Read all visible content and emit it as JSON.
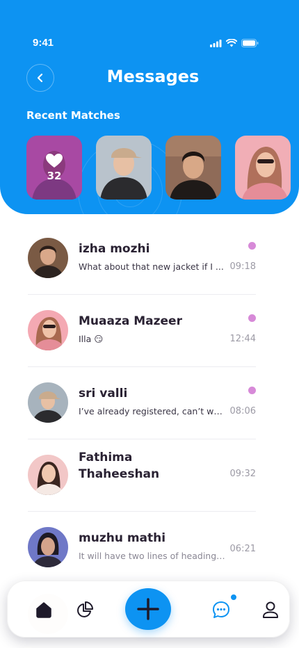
{
  "status_bar": {
    "time": "9:41"
  },
  "header": {
    "title": "Messages",
    "recent_matches_label": "Recent Matches"
  },
  "recent_matches": [
    {
      "likes_count": "32",
      "colors": [
        "#8a2f6f",
        "#5b2a46"
      ]
    },
    {
      "colors": [
        "#b8c0c8",
        "#4b3a2e"
      ]
    },
    {
      "colors": [
        "#8c6a58",
        "#2a1f1c"
      ]
    },
    {
      "colors": [
        "#f3b0b8",
        "#d88890"
      ]
    }
  ],
  "messages": [
    {
      "name": "izha mozhi",
      "preview": "What about that new jacket if I ...",
      "time": "09:18",
      "unread": true,
      "avatar_colors": [
        "#6d4a36",
        "#2c2320"
      ]
    },
    {
      "name": "Muaaza Mazeer",
      "preview": "Illa 😏",
      "time": "12:44",
      "unread": true,
      "avatar_colors": [
        "#f4a9b3",
        "#c97a82"
      ]
    },
    {
      "name": "sri valli",
      "preview": "I’ve already registered, can’t wai...",
      "time": "08:06",
      "unread": true,
      "avatar_colors": [
        "#a7b3bd",
        "#3b3530"
      ]
    },
    {
      "name": "Fathima Thaheeshan",
      "preview": "",
      "time": "09:32",
      "unread": false,
      "avatar_colors": [
        "#f2c7c7",
        "#b07a6a"
      ]
    },
    {
      "name": "muzhu mathi",
      "preview": "It will have two lines of heading ...",
      "time": "06:21",
      "unread": false,
      "avatar_colors": [
        "#6f78c7",
        "#2d2a3a"
      ]
    }
  ],
  "nav": {
    "items": [
      "home-icon",
      "chart-icon",
      "add-icon",
      "chat-icon",
      "profile-icon"
    ],
    "accent": "#0d93f2"
  },
  "colors": {
    "primary": "#0d93f2",
    "unread": "#d78ad8"
  }
}
